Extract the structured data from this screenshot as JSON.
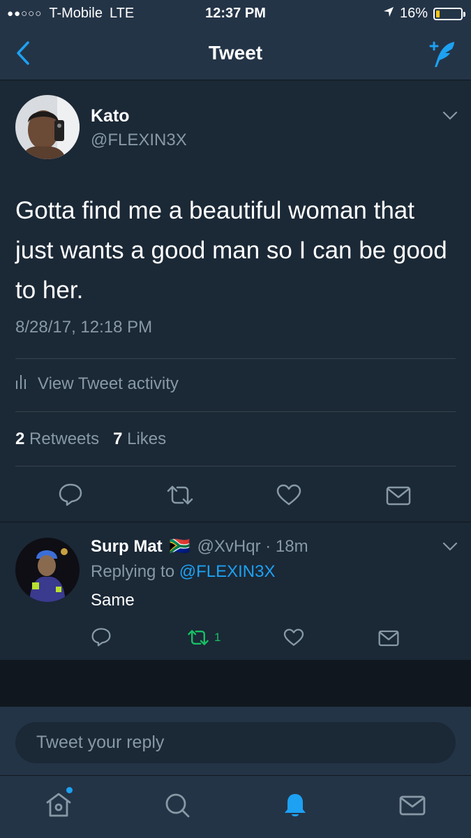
{
  "status_bar": {
    "signal": "●●○○○",
    "carrier": "T-Mobile",
    "network": "LTE",
    "time": "12:37 PM",
    "battery_percent": "16%",
    "battery_level": 0.16
  },
  "nav": {
    "title": "Tweet"
  },
  "tweet": {
    "author_name": "Kato",
    "author_handle": "@FLEXIN3X",
    "text": "Gotta find me a beautiful woman that just wants a good man so I can be good to her.",
    "timestamp": "8/28/17, 12:18 PM",
    "activity_label": "View Tweet activity",
    "retweet_count": "2",
    "retweet_label": "Retweets",
    "like_count": "7",
    "like_label": "Likes"
  },
  "reply": {
    "author_name": "Surp Mat",
    "flag": "🇿🇦",
    "handle_time": "@XvHqr · 18m",
    "replying_prefix": "Replying to",
    "replying_to": "@FLEXIN3X",
    "text": "Same",
    "retweet_count": "1"
  },
  "compose": {
    "placeholder": "Tweet your reply"
  },
  "colors": {
    "background": "#1b2836",
    "bar": "#243447",
    "accent": "#1da1f2",
    "secondary_text": "#8899a6",
    "retweet_green": "#17bf63"
  },
  "icons": {
    "nav": [
      "back-chevron-icon",
      "compose-tweet-icon"
    ],
    "actions": [
      "reply-icon",
      "retweet-icon",
      "like-icon",
      "direct-message-icon"
    ],
    "tabs": [
      "home-icon",
      "search-icon",
      "notifications-icon",
      "messages-icon"
    ]
  }
}
